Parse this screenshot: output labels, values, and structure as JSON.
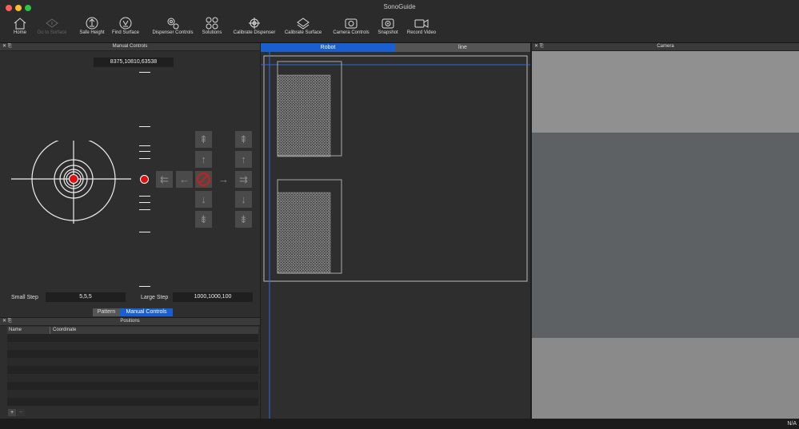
{
  "app": {
    "title": "SonoGuide"
  },
  "toolbar": {
    "home": "Home",
    "go_to_surface": "Go to Surface",
    "safe_height": "Safe Height",
    "find_surface": "Find Surface",
    "dispenser_controls": "Dispenser Controls",
    "solutions": "Solutions",
    "calibrate_dispenser": "Calibrate Dispenser",
    "calibrate_surface": "Calibrate Surface",
    "camera_controls": "Camera Controls",
    "snapshot": "Snapshot",
    "record_video": "Record Video"
  },
  "manual": {
    "header": "Manual Controls",
    "dock_controls": "✕ ⎘",
    "coordinate": "8375,10810,63538",
    "small_step_label": "Small Step",
    "small_step_value": "5,5,5",
    "large_step_label": "Large Step",
    "large_step_value": "1000,1000,100",
    "tab_pattern": "Pattern",
    "tab_manual": "Manual Controls"
  },
  "positions": {
    "header": "Positions",
    "dock_controls": "✕ ⎘",
    "col_name": "Name",
    "col_coordinate": "Coordinate",
    "add": "+",
    "remove": "−"
  },
  "center": {
    "tab_robot": "Robot",
    "tab_line": "line"
  },
  "camera": {
    "header": "Camera",
    "dock_controls": "✕ ⎘"
  },
  "status": {
    "text": "N/A"
  },
  "colors": {
    "accent": "#1a5fd0",
    "stop": "#c8201c",
    "position_dot": "#e01010"
  }
}
